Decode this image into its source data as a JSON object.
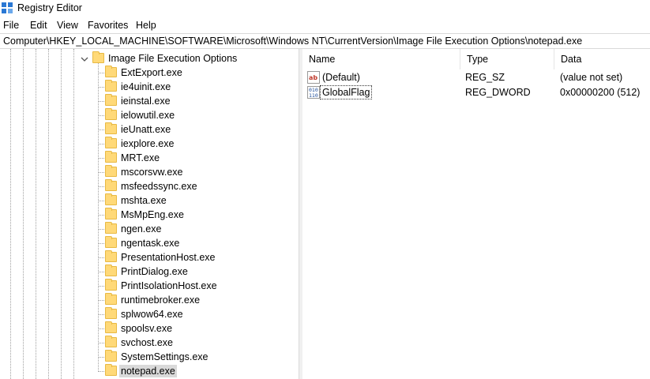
{
  "window": {
    "title": "Registry Editor",
    "icon": "registry-editor-icon"
  },
  "menu": [
    "File",
    "Edit",
    "View",
    "Favorites",
    "Help"
  ],
  "address": "Computer\\HKEY_LOCAL_MACHINE\\SOFTWARE\\Microsoft\\Windows NT\\CurrentVersion\\Image File Execution Options\\notepad.exe",
  "tree": {
    "parent": {
      "label": "Image File Execution Options",
      "expanded": true,
      "icon": "folder-icon"
    },
    "children": [
      {
        "label": "ExtExport.exe"
      },
      {
        "label": "ie4uinit.exe"
      },
      {
        "label": "ieinstal.exe"
      },
      {
        "label": "ielowutil.exe"
      },
      {
        "label": "ieUnatt.exe"
      },
      {
        "label": "iexplore.exe"
      },
      {
        "label": "MRT.exe"
      },
      {
        "label": "mscorsvw.exe"
      },
      {
        "label": "msfeedssync.exe"
      },
      {
        "label": "mshta.exe"
      },
      {
        "label": "MsMpEng.exe"
      },
      {
        "label": "ngen.exe"
      },
      {
        "label": "ngentask.exe"
      },
      {
        "label": "PresentationHost.exe"
      },
      {
        "label": "PrintDialog.exe"
      },
      {
        "label": "PrintIsolationHost.exe"
      },
      {
        "label": "runtimebroker.exe"
      },
      {
        "label": "splwow64.exe"
      },
      {
        "label": "spoolsv.exe"
      },
      {
        "label": "svchost.exe"
      },
      {
        "label": "SystemSettings.exe"
      },
      {
        "label": "notepad.exe",
        "selected": true
      }
    ]
  },
  "values": {
    "columns": [
      "Name",
      "Type",
      "Data"
    ],
    "rows": [
      {
        "name": "(Default)",
        "type": "REG_SZ",
        "data": "(value not set)",
        "icon": "string-value-icon"
      },
      {
        "name": "GlobalFlag",
        "type": "REG_DWORD",
        "data": "0x00000200 (512)",
        "icon": "binary-value-icon",
        "focused": true
      }
    ]
  },
  "colors": {
    "folder": "#ffd978",
    "selection": "#d9d9d9",
    "string_icon": "#c0392b",
    "binary_icon": "#1f4e9c"
  }
}
